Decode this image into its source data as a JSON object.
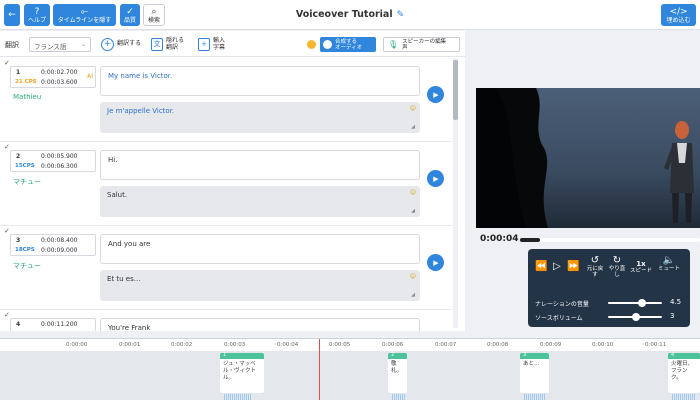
{
  "header": {
    "title": "Voiceover Tutorial",
    "back_icon": "arrow-left",
    "help_label": "ヘルプ",
    "timeline_label": "タイムラインを隠す",
    "quality_label": "品質",
    "search_label": "検索",
    "embed_label": "埋め込む"
  },
  "toolbar": {
    "translate_label": "翻訳",
    "language": "フランス語",
    "translate_btn": "翻訳する",
    "hidden_translate_line1": "隠れる",
    "hidden_translate_line2": "翻訳",
    "import_subs_line1": "輸入",
    "import_subs_line2": "字幕",
    "synth_audio_line1": "合成する",
    "synth_audio_line2": "オーディオ",
    "speaker_edit_line1": "スピーカーの編集",
    "speaker_edit_line2": "声"
  },
  "segments": [
    {
      "num": "1",
      "cps": "21 CPS",
      "cps_color": "#f0a020",
      "start": "0:00:02.700",
      "end": "0:00:03.600",
      "speaker": "Mathieu",
      "source": "My name is Victor.",
      "source_color": "#2f6fc6",
      "target": "Je m'appelle Victor.",
      "target_color": "#2f6fc6",
      "ai_badge": "AI"
    },
    {
      "num": "2",
      "cps": "15CPS",
      "cps_color": "#2f86dc",
      "start": "0:00:05.900",
      "end": "0:00:06.300",
      "speaker": "マチュー",
      "source": "Hi.",
      "source_color": "#333333",
      "target": "Salut.",
      "target_color": "#333333",
      "ai_badge": ""
    },
    {
      "num": "3",
      "cps": "18CPS",
      "cps_color": "#2f86dc",
      "start": "0:00:08.400",
      "end": "0:00:09.000",
      "speaker": "マチュー",
      "source": "And you are",
      "source_color": "#333333",
      "target": "Et tu es...",
      "target_color": "#333333",
      "ai_badge": ""
    },
    {
      "num": "4",
      "cps": "",
      "cps_color": "#2f86dc",
      "start": "0:00:11.200",
      "end": "",
      "speaker": "",
      "source": "You're Frank",
      "source_color": "#333333",
      "target": "",
      "target_color": "#333333",
      "ai_badge": ""
    }
  ],
  "player": {
    "current_time": "0:00:04",
    "back_label_1": "元に戻",
    "back_label_2": "す",
    "redo_label_1": "やり直",
    "redo_label_2": "し",
    "speed_value": "1x",
    "speed_label": "スピード",
    "mute_label": "ミュート",
    "narration_volume_label": "ナレーションの音量",
    "narration_volume": "4.5",
    "source_volume_label": "ソースボリューム",
    "source_volume": "3"
  },
  "timeline": {
    "ticks": [
      "0:00:00",
      "0:00:01",
      "0:00:02",
      "0:00:03",
      "0:00:04",
      "0:00:05",
      "0:00:06",
      "0:00:07",
      "0:00:08",
      "0:00:09",
      "0:00:10",
      "0:00:11"
    ],
    "blocks": [
      {
        "num": "1",
        "text": "ジュ・マッベル・ヴィクトル。"
      },
      {
        "num": "2",
        "text": "敬礼。"
      },
      {
        "num": "3",
        "text": "あと..."
      },
      {
        "num": "4",
        "text": "火曜日、フランク。"
      }
    ]
  },
  "colors": {
    "accent": "#2f86dc",
    "speaker": "#2aa876",
    "timeline_block": "#4cc39a",
    "playhead": "#e05050"
  }
}
